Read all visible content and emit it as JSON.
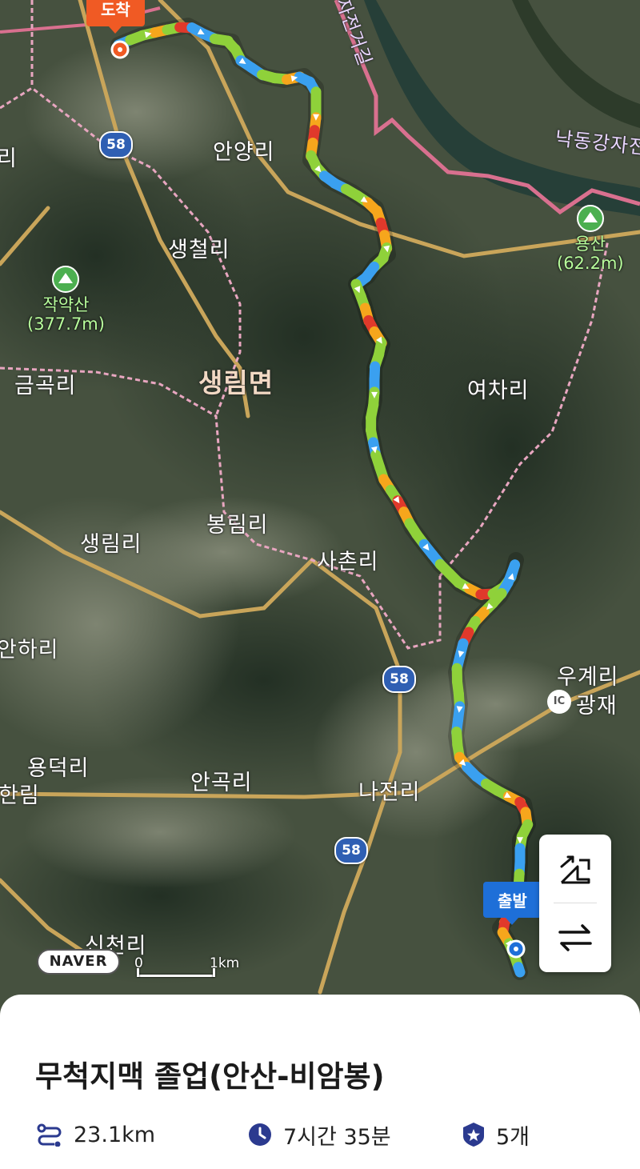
{
  "map": {
    "places": [
      {
        "name": "안양리"
      },
      {
        "name": "생철리"
      },
      {
        "name": "금곡리"
      },
      {
        "name": "생림면"
      },
      {
        "name": "여차리"
      },
      {
        "name": "봉림리"
      },
      {
        "name": "생림리"
      },
      {
        "name": "사촌리"
      },
      {
        "name": "안하리"
      },
      {
        "name": "우계리"
      },
      {
        "name": "광재"
      },
      {
        "name": "용덕리"
      },
      {
        "name": "안곡리"
      },
      {
        "name": "나전리"
      },
      {
        "name": "한림"
      },
      {
        "name": "신천리"
      },
      {
        "name": "리"
      },
      {
        "name": "낙동강자전거"
      },
      {
        "name": "자전거길"
      }
    ],
    "mountains": [
      {
        "name": "작약산",
        "elevation": "(377.7m)"
      },
      {
        "name": "용산",
        "elevation": "(62.2m)"
      }
    ],
    "highway_number": "58",
    "ic_badge": "IC",
    "arrival_label": "도착",
    "departure_label": "출발",
    "logo": "NAVER",
    "scale": {
      "zero": "0",
      "distance": "1km"
    },
    "colors": {
      "route_blue": "#3aa0f0",
      "route_green": "#8fd13a",
      "route_orange": "#f6a61c",
      "route_red": "#e0392b",
      "road": "#c9a55a",
      "boundary": "#e8a6c0"
    }
  },
  "controls": {
    "top_icon": "route-edit-icon",
    "bottom_icon": "swap-direction-icon"
  },
  "course": {
    "title": "무척지맥 졸업(안산-비암봉)",
    "distance": "23.1km",
    "duration": "7시간 35분",
    "waypoints": "5개",
    "icons": [
      "distance-icon",
      "clock-icon",
      "badge-icon"
    ]
  }
}
